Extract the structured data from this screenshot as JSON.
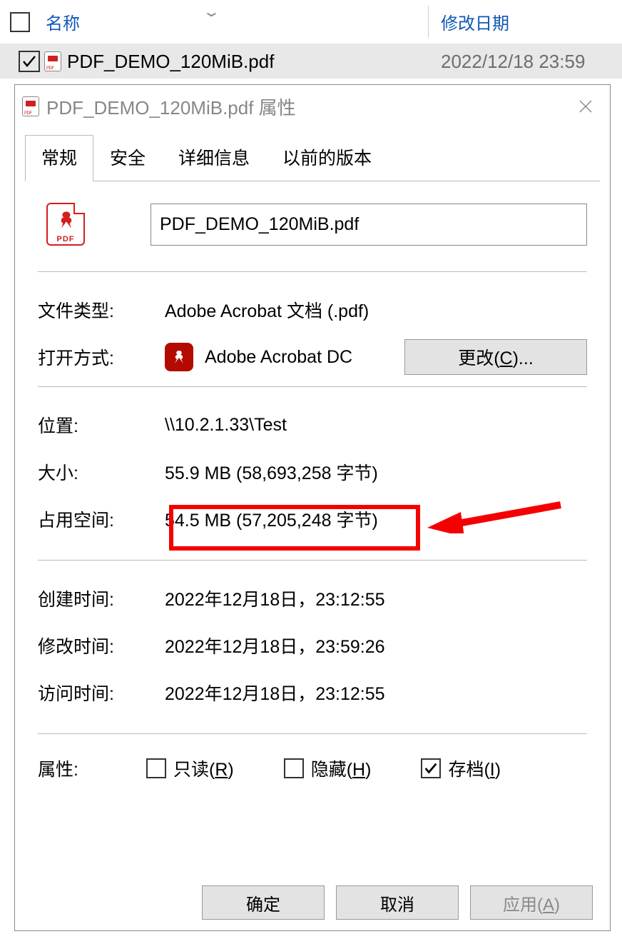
{
  "explorer": {
    "header": {
      "name": "名称",
      "date": "修改日期"
    },
    "row": {
      "filename": "PDF_DEMO_120MiB.pdf",
      "date": "2022/12/18 23:59"
    }
  },
  "dialog": {
    "title": "PDF_DEMO_120MiB.pdf 属性",
    "tabs": {
      "general": "常规",
      "security": "安全",
      "details": "详细信息",
      "prev": "以前的版本"
    },
    "filename": "PDF_DEMO_120MiB.pdf",
    "filetype_label": "文件类型:",
    "filetype_value": "Adobe Acrobat 文档 (.pdf)",
    "openwith_label": "打开方式:",
    "openwith_value": "Adobe Acrobat DC",
    "change_btn_pre": "更改(",
    "change_btn_key": "C",
    "change_btn_post": ")...",
    "location_label": "位置:",
    "location_value": "\\\\10.2.1.33\\Test",
    "size_label": "大小:",
    "size_value": "55.9 MB (58,693,258 字节)",
    "ondisk_label": "占用空间:",
    "ondisk_value": "54.5 MB (57,205,248 字节)",
    "created_label": "创建时间:",
    "created_value": "2022年12月18日，23:12:55",
    "modified_label": "修改时间:",
    "modified_value": "2022年12月18日，23:59:26",
    "accessed_label": "访问时间:",
    "accessed_value": "2022年12月18日，23:12:55",
    "attr_label": "属性:",
    "readonly_pre": "只读(",
    "readonly_key": "R",
    "readonly_post": ")",
    "hidden_pre": "隐藏(",
    "hidden_key": "H",
    "hidden_post": ")",
    "archive_pre": "存档(",
    "archive_key": "I",
    "archive_post": ")",
    "ok": "确定",
    "cancel": "取消",
    "apply_pre": "应用(",
    "apply_key": "A",
    "apply_post": ")"
  }
}
